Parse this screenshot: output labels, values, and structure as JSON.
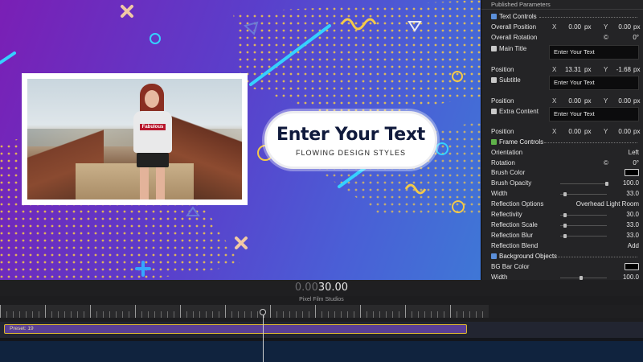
{
  "viewer": {
    "title_main": "Enter Your Text",
    "title_sub": "FLOWING DESIGN STYLES",
    "shirt_label": "Fabulous"
  },
  "panel": {
    "header": "Published Parameters",
    "text_controls": "Text Controls",
    "overall_position": {
      "label": "Overall Position",
      "x_label": "X",
      "x": "0.00",
      "x_unit": "px",
      "y_label": "Y",
      "y": "0.00",
      "y_unit": "px"
    },
    "overall_rotation": {
      "label": "Overall Rotation",
      "value": "0°"
    },
    "main_title": {
      "label": "Main Title",
      "value": "Enter Your Text"
    },
    "main_title_position": {
      "label": "Position",
      "x_label": "X",
      "x": "13.31",
      "x_unit": "px",
      "y_label": "Y",
      "y": "-1.68",
      "y_unit": "px"
    },
    "subtitle": {
      "label": "Subtitle",
      "value": "Enter Your Text"
    },
    "subtitle_position": {
      "label": "Position",
      "x_label": "X",
      "x": "0.00",
      "x_unit": "px",
      "y_label": "Y",
      "y": "0.00",
      "y_unit": "px"
    },
    "extra_content": {
      "label": "Extra Content",
      "value": "Enter Your Text"
    },
    "extra_position": {
      "label": "Position",
      "x_label": "X",
      "x": "0.00",
      "x_unit": "px",
      "y_label": "Y",
      "y": "0.00",
      "y_unit": "px"
    },
    "frame_controls": "Frame Controls",
    "orientation": {
      "label": "Orientation",
      "value": "Left"
    },
    "rotation": {
      "label": "Rotation",
      "value": "0°"
    },
    "brush_color": {
      "label": "Brush Color",
      "color": "#000000"
    },
    "brush_opacity": {
      "label": "Brush Opacity",
      "value": "100.0",
      "level": 1.0
    },
    "width": {
      "label": "Width",
      "value": "33.0",
      "level": 0.1
    },
    "reflection_options": {
      "label": "Reflection Options",
      "value": "Overhead Light Room"
    },
    "reflectivity": {
      "label": "Reflectivity",
      "value": "30.0",
      "level": 0.1
    },
    "reflection_scale": {
      "label": "Reflection Scale",
      "value": "33.0",
      "level": 0.1
    },
    "reflection_blur": {
      "label": "Reflection Blur",
      "value": "33.0",
      "level": 0.1
    },
    "reflection_blend": {
      "label": "Reflection Blend",
      "value": "Add"
    },
    "background_objects": "Background Objects",
    "bg_bar_color": {
      "label": "BG Bar Color",
      "color": "#000000"
    },
    "bg_width": {
      "label": "Width",
      "value": "100.0",
      "level": 0.45
    }
  },
  "timeline": {
    "timecode_dim": "0.00",
    "timecode_bright": "30.00",
    "project_name": "Pixel Film Studios",
    "clip_label": "Preset: 19"
  },
  "colors": {
    "accent_blue": "#5b8fd9",
    "accent_green": "#5fb24a",
    "clip_border": "#d9b430",
    "clip_fill": "#5a3f96"
  }
}
